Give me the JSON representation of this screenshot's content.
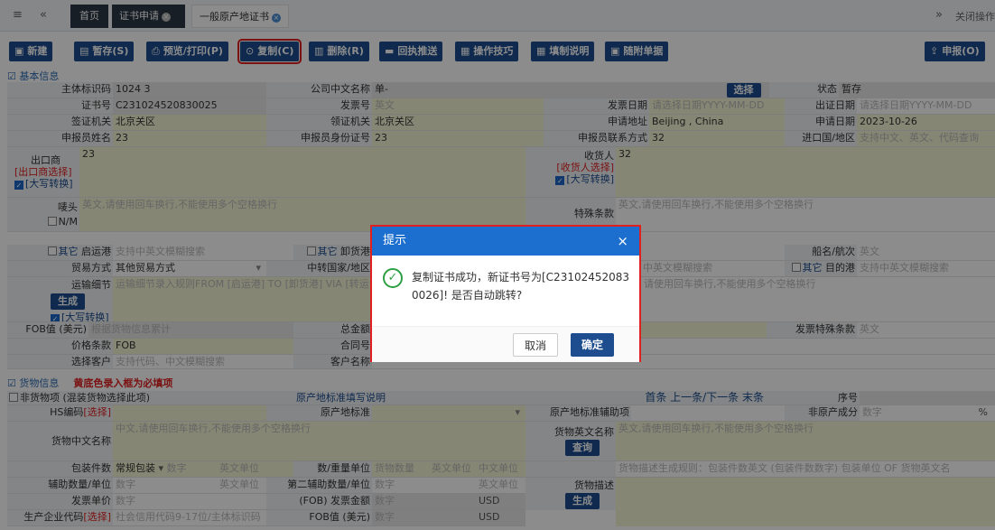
{
  "nav": {
    "menu_glyph": "≡",
    "back_glyph": "«",
    "forward_glyph": "»",
    "close_ops": "关闭操作"
  },
  "tabs": [
    {
      "label": "首页"
    },
    {
      "label": "证书申请"
    },
    {
      "label": "一般原产地证书"
    }
  ],
  "toolbar": {
    "new": "新建",
    "save": "暂存(S)",
    "print": "预览/打印(P)",
    "copy": "复制(C)",
    "delete": "删除(R)",
    "receipt": "回执推送",
    "tips": "操作技巧",
    "fill_help": "填制说明",
    "attach": "随附单据",
    "submit": "申报(O)"
  },
  "basic": {
    "title": "基本信息",
    "entity_id_label": "主体标识码",
    "entity_id_value": "1024      3",
    "company_cn_label": "公司中文名称",
    "company_cn_value": "单-",
    "select_btn": "选择",
    "status_label": "状态",
    "status_value": "暂存",
    "cert_no_label": "证书号",
    "cert_no_value": "C231024520830025",
    "invoice_no_label": "发票号",
    "invoice_no_ph": "英文",
    "invoice_date_label": "发票日期",
    "invoice_date_ph": "请选择日期YYYY-MM-DD",
    "issue_date_label": "出证日期",
    "issue_date_ph": "请选择日期YYYY-MM-DD",
    "visa_org_label": "签证机关",
    "visa_org_value": "北京关区",
    "pickup_org_label": "领证机关",
    "pickup_org_value": "北京关区",
    "apply_addr_label": "申请地址",
    "apply_addr_value": "Beijing , China",
    "apply_date_label": "申请日期",
    "apply_date_value": "2023-10-26",
    "declarant_label": "申报员姓名",
    "declarant_value": "23",
    "declarant_id_label": "申报员身份证号",
    "declarant_id_value": "23",
    "declarant_tel_label": "申报员联系方式",
    "declarant_tel_value": "32",
    "import_country_label": "进口国/地区",
    "import_country_ph": "支持中文、英文、代码查询",
    "exporter_label": "出口商",
    "exporter_select": "[出口商选择]",
    "exporter_upper": "[大写转换]",
    "exporter_value": "23",
    "consignee_label": "收货人",
    "consignee_select": "[收货人选择]",
    "consignee_upper": "[大写转换]",
    "consignee_value": "32",
    "marks_label": "唛头",
    "marks_ph": "英文,请使用回车换行,不能使用多个空格换行",
    "nm_label": "N/M",
    "special_terms_label": "特殊条款",
    "special_terms_ph": "英文,请使用回车换行,不能使用多个空格换行",
    "other1": "其它",
    "load_port_label": "启运港",
    "load_port_ph": "支持中英文模糊搜索",
    "other2": "其它",
    "discharge_port_label": "卸货港",
    "ship_label": "船名/航次",
    "ship_ph": "英文",
    "trade_mode_label": "贸易方式",
    "trade_mode_value": "其他贸易方式",
    "transit_label": "中转国家/地区",
    "transit_ph": "中英文模糊搜索",
    "other3": "其它",
    "dest_port_label": "目的港",
    "dest_port_ph": "支持中英文模糊搜索",
    "transport_label": "运输细节",
    "transport_ph": "运输细节录入规则FROM [启运港] TO [卸货港] VIA [转运",
    "transport_ph2": "请使用回车换行,不能使用多个空格换行",
    "gen_btn": "生成",
    "upper3": "[大写转换]",
    "fob_label": "FOB值 (美元)",
    "fob_ph": "根据货物信息累计",
    "total_label": "总金额",
    "invoice_special_label": "发票特殊条款",
    "invoice_special_ph": "英文",
    "price_term_label": "价格条款",
    "price_term_value": "FOB",
    "contract_label": "合同号",
    "select_customer_label": "选择客户",
    "select_customer_ph": "支持代码、中文模糊搜索",
    "customer_name_label": "客户名称"
  },
  "goods": {
    "title": "货物信息",
    "required_note": "黄底色录入框为必填项",
    "non_goods": "非货物项 (混装货物选择此项)",
    "origin_std_link": "原产地标准填写说明",
    "nav": "首条 上一条/下一条 末条",
    "seq_label": "序号",
    "hs_label": "HS编码",
    "hs_select": "[选择]",
    "origin_std_label": "原产地标准",
    "origin_aux_label": "原产地标准辅助项",
    "non_origin_label": "非原产成分",
    "non_origin_ph": "数字",
    "percent": "%",
    "cn_name_label": "货物中文名称",
    "cn_name_ph": "中文,请使用回车换行,不能使用多个空格换行",
    "en_name_label": "货物英文名称",
    "en_name_ph": "英文,请使用回车换行,不能使用多个空格换行",
    "query_btn": "查询",
    "pkg_label": "包装件数",
    "pkg_value": "常规包装",
    "pkg_num_ph": "数字",
    "pkg_unit_ph": "英文单位",
    "qty_label": "数/重量单位",
    "qty_ph": "货物数量",
    "qty_unit_en": "英文单位",
    "qty_unit_cn": "中文单位",
    "desc_rule": "货物描述生成规则：包装件数英文 (包装件数数字) 包装单位 OF 货物英文名",
    "aux_qty_label": "辅助数量/单位",
    "aux_qty_ph": "数字",
    "aux_unit_ph": "英文单位",
    "aux2_label": "第二辅助数量/单位",
    "aux2_ph": "数字",
    "aux2_unit": "英文单位",
    "desc_label": "货物描述",
    "desc_btn": "生成",
    "unit_price_label": "发票单价",
    "unit_price_ph": "数字",
    "fob_inv_label": "(FOB) 发票金额",
    "fob_inv_ph": "数字",
    "usd1": "USD",
    "producer_label": "生产企业代码",
    "producer_select": "[选择]",
    "producer_ph": "社会信用代码9-17位/主体标识码",
    "fob_usd_label": "FOB值 (美元)",
    "fob_usd_ph": "数字",
    "usd2": "USD"
  },
  "dialog": {
    "title": "提示",
    "close": "×",
    "message": "复制证书成功，新证书号为[C231024520830026]! 是否自动跳转?",
    "cancel": "取消",
    "confirm": "确定"
  }
}
